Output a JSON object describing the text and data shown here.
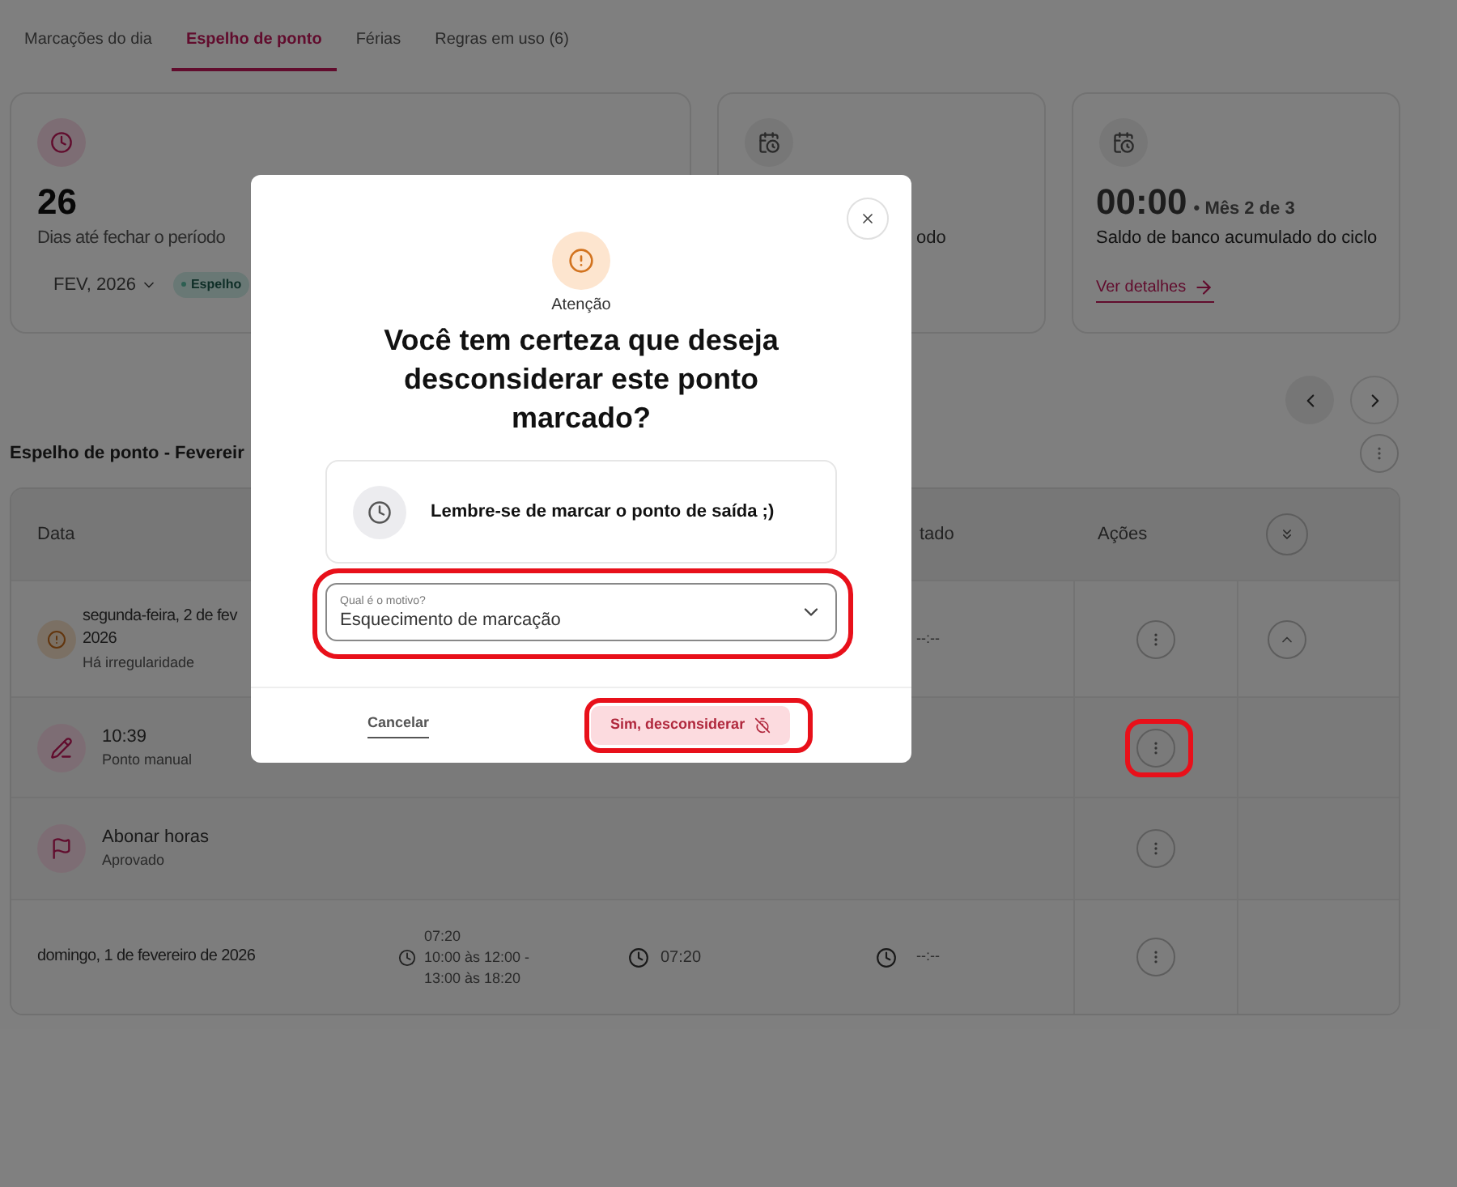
{
  "tabs": [
    {
      "label": "Marcações do dia",
      "selected": false
    },
    {
      "label": "Espelho de ponto",
      "selected": true
    },
    {
      "label": "Férias",
      "selected": false
    },
    {
      "label": "Regras em uso (6)",
      "selected": false
    }
  ],
  "summary_cards": [
    {
      "kind": "countdown",
      "value": "26",
      "caption": "Dias até fechar o período",
      "period": "FEV, 2026",
      "badge": "Espelho"
    },
    {
      "kind": "partial",
      "caption": "odo"
    },
    {
      "kind": "balance",
      "value": "00:00",
      "value_note": "• Mês 2 de 3",
      "caption": "Saldo de banco acumulado do ciclo",
      "link": "Ver detalhes"
    }
  ],
  "section_title": "Espelho de ponto - Fevereir",
  "table": {
    "columns": [
      "Data",
      "tado",
      "Ações"
    ],
    "rows": [
      {
        "kind": "irregular_day",
        "date_lines": [
          "segunda-feira, 2 de fev",
          "2026"
        ],
        "status": "Há irregularidade",
        "result": "--:--",
        "expanded": true,
        "highlighted": false
      },
      {
        "kind": "manual_entry",
        "title": "10:39",
        "subtitle": "Ponto manual",
        "highlighted": true
      },
      {
        "kind": "approved_request",
        "title": "Abonar horas",
        "subtitle": "Aprovado",
        "highlighted": false
      },
      {
        "kind": "day",
        "date_lines": [
          "domingo, 1 de fevereiro de 2026"
        ],
        "marks": [
          "07:20",
          "10:00 às 12:00 -",
          "13:00 às 18:20"
        ],
        "worked": "07:20",
        "result": "--:--",
        "highlighted": false
      }
    ]
  },
  "modal": {
    "alert_label": "Atenção",
    "title": "Você tem certeza que deseja desconsiderar este ponto marcado?",
    "reminder": "Lembre-se de marcar o ponto de saída ;)",
    "select": {
      "label": "Qual é o motivo?",
      "value": "Esquecimento de marcação",
      "highlighted": true
    },
    "cancel": "Cancelar",
    "confirm": {
      "label": "Sim, desconsiderar",
      "highlighted": true
    }
  }
}
